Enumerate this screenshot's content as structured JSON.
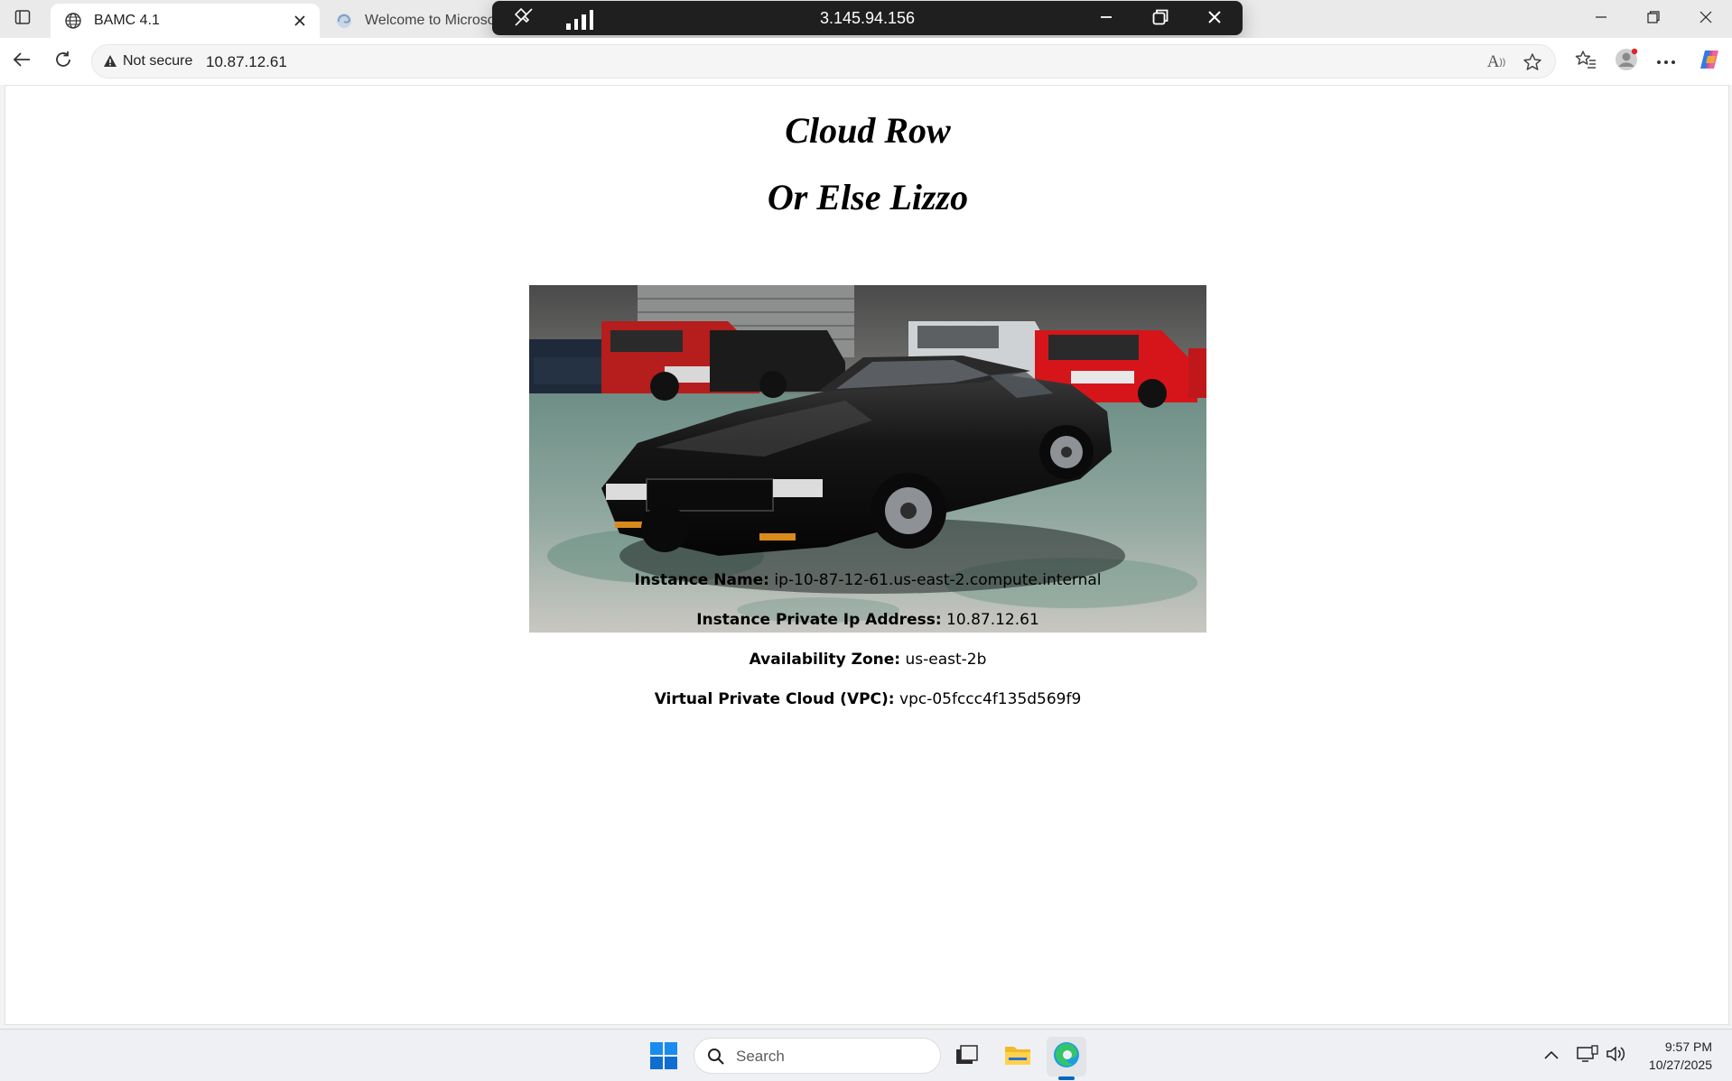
{
  "browser": {
    "tabs": [
      {
        "title": "BAMC 4.1",
        "active": true
      },
      {
        "title": "Welcome to Microsoft",
        "active": false
      }
    ],
    "address": {
      "security_label": "Not secure",
      "url": "10.87.12.61"
    },
    "read_aloud_glyph": "A"
  },
  "remote_session": {
    "title": "3.145.94.156"
  },
  "page": {
    "title_line1": "Cloud Row",
    "title_line2": "Or Else Lizzo",
    "image_subject": "black coupe parked in a garage with red trucks",
    "fields": [
      {
        "label": "Instance Name:",
        "value": "ip-10-87-12-61.us-east-2.compute.internal"
      },
      {
        "label": "Instance Private Ip Address:",
        "value": "10.87.12.61"
      },
      {
        "label": "Availability Zone:",
        "value": "us-east-2b"
      },
      {
        "label": "Virtual Private Cloud (VPC):",
        "value": "vpc-05fccc4f135d569f9"
      }
    ]
  },
  "taskbar": {
    "search_placeholder": "Search",
    "time": "9:57 PM",
    "date": "10/27/2025"
  },
  "colors": {
    "accent": "#0067c0",
    "remote_bar": "#1f1f1f",
    "tabstrip": "#eaeaea"
  }
}
